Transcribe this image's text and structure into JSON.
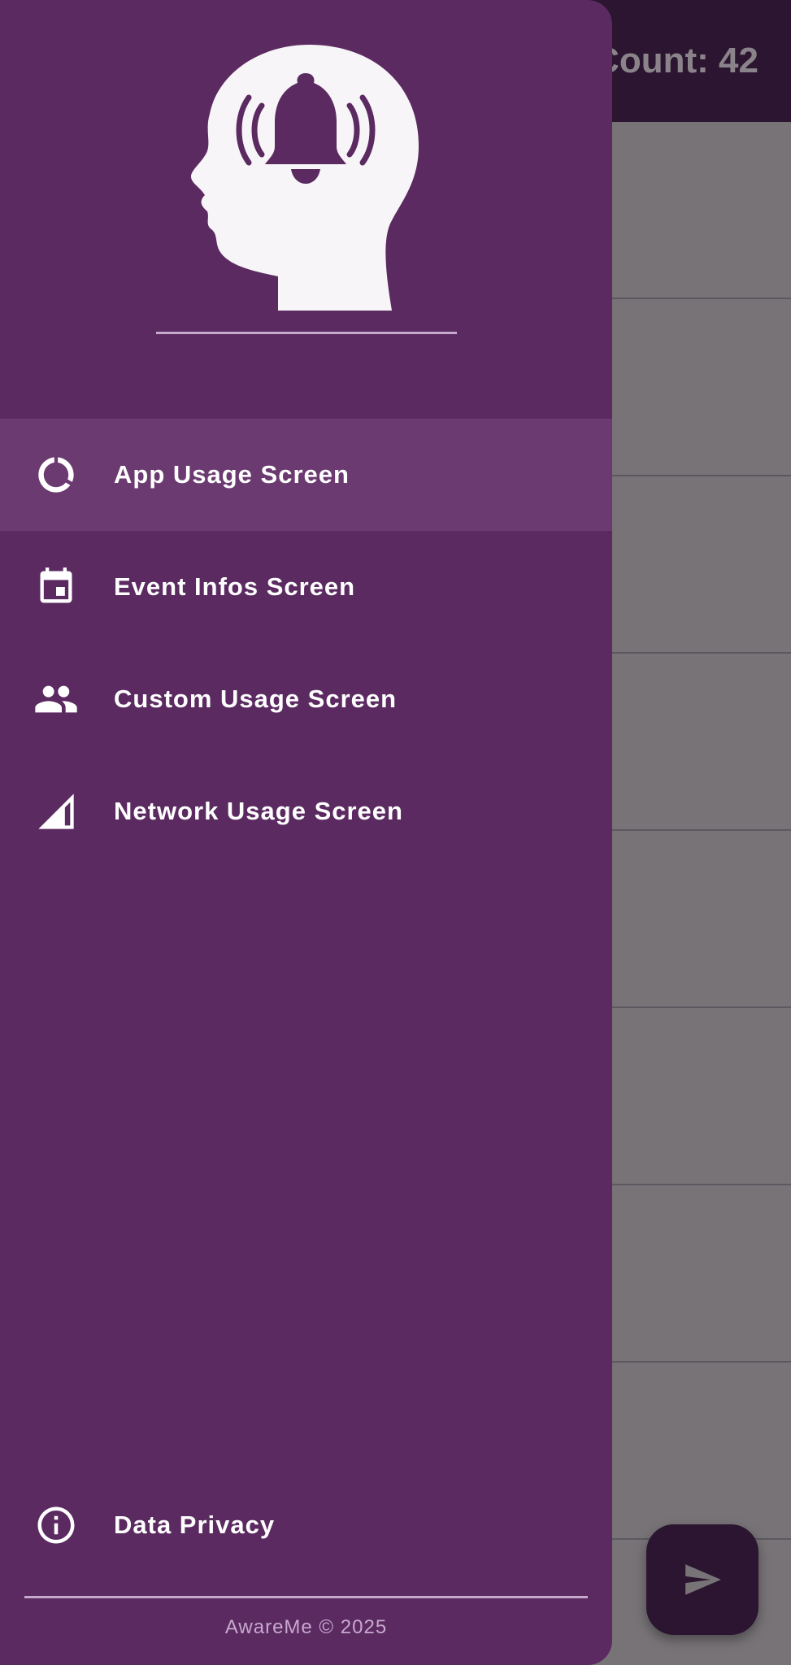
{
  "app_bar": {
    "title": "Count: 42"
  },
  "list": {
    "row_count": 8
  },
  "fab": {
    "icon": "send-icon"
  },
  "drawer": {
    "header": {
      "logo": "head-with-bell-logo"
    },
    "items": [
      {
        "label": "App Usage Screen",
        "icon": "donut-chart-icon",
        "selected": true
      },
      {
        "label": "Event Infos Screen",
        "icon": "calendar-icon",
        "selected": false
      },
      {
        "label": "Custom Usage Screen",
        "icon": "people-icon",
        "selected": false
      },
      {
        "label": "Network Usage Screen",
        "icon": "signal-icon",
        "selected": false
      }
    ],
    "bottom_item": {
      "label": "Data Privacy",
      "icon": "info-icon"
    },
    "footer": "AwareMe © 2025"
  },
  "colors": {
    "drawer_background": "#5b2a61",
    "selected_item": "#6a3a70",
    "app_bar": "#2b1530",
    "scrim_content": "#777377",
    "divider": "#c7a9cd",
    "text": "#ffffff"
  }
}
